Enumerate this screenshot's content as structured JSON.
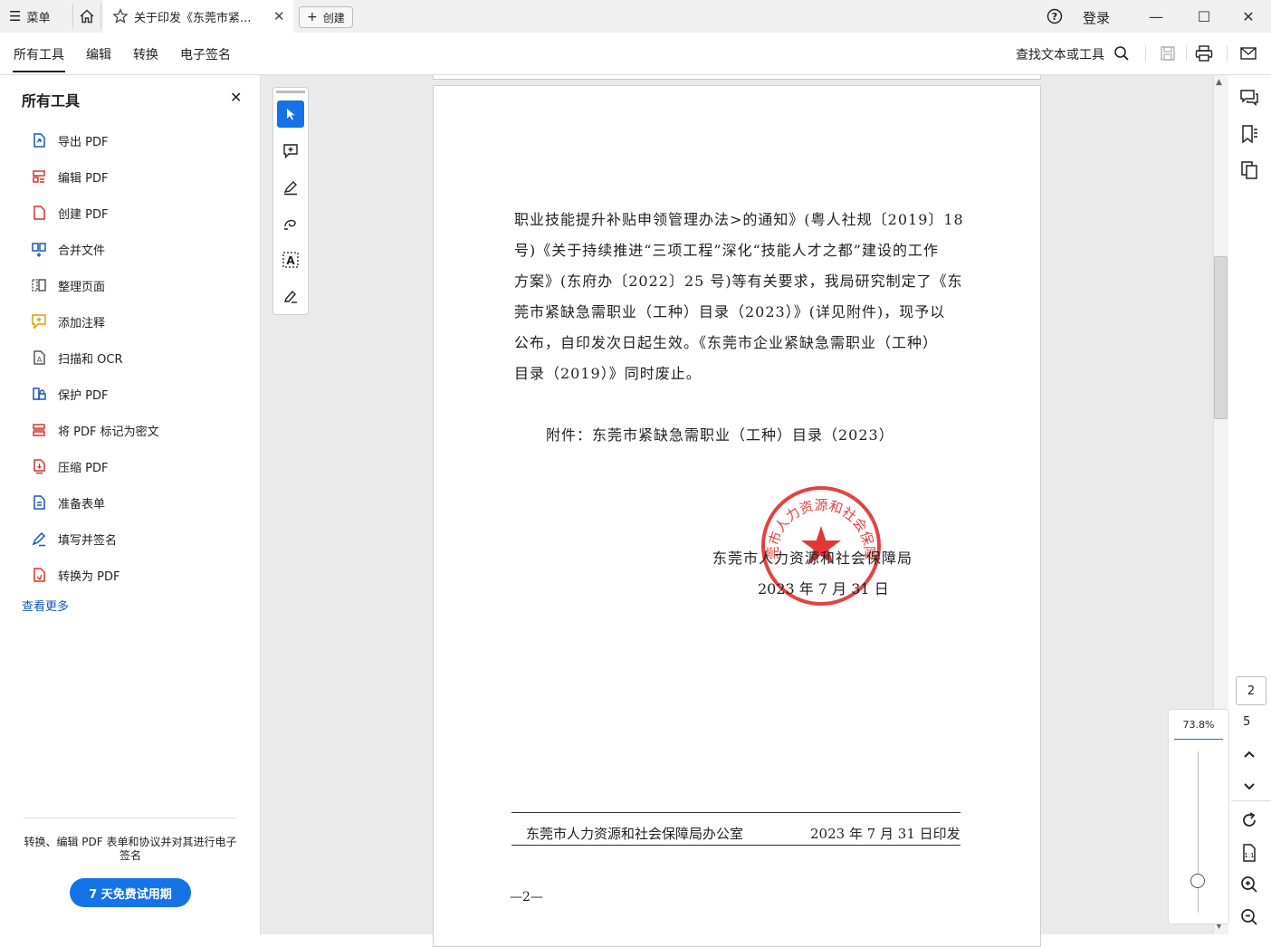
{
  "titlebar": {
    "menu_label": "菜单",
    "tab_title": "关于印发《东莞市紧...",
    "create_label": "创建",
    "login_label": "登录"
  },
  "menubar": {
    "tabs": [
      "所有工具",
      "编辑",
      "转换",
      "电子签名"
    ],
    "active_tab": "所有工具",
    "search_tools": "查找文本或工具"
  },
  "left_panel": {
    "title": "所有工具",
    "tools": [
      {
        "label": "导出 PDF",
        "icon": "export-pdf-icon",
        "color": "#1a55c0"
      },
      {
        "label": "编辑 PDF",
        "icon": "edit-pdf-icon",
        "color": "#d6352b"
      },
      {
        "label": "创建 PDF",
        "icon": "create-pdf-icon",
        "color": "#d6352b"
      },
      {
        "label": "合并文件",
        "icon": "combine-files-icon",
        "color": "#1a55c0"
      },
      {
        "label": "整理页面",
        "icon": "organize-pages-icon",
        "color": "#555555"
      },
      {
        "label": "添加注释",
        "icon": "comment-icon",
        "color": "#e69a00"
      },
      {
        "label": "扫描和 OCR",
        "icon": "scan-ocr-icon",
        "color": "#555555"
      },
      {
        "label": "保护 PDF",
        "icon": "protect-pdf-icon",
        "color": "#1a55c0"
      },
      {
        "label": "将 PDF 标记为密文",
        "icon": "redact-icon",
        "color": "#d6352b"
      },
      {
        "label": "压缩 PDF",
        "icon": "compress-pdf-icon",
        "color": "#d6352b"
      },
      {
        "label": "准备表单",
        "icon": "prepare-form-icon",
        "color": "#1a55c0"
      },
      {
        "label": "填写并签名",
        "icon": "fill-sign-icon",
        "color": "#1a55c0"
      },
      {
        "label": "转换为 PDF",
        "icon": "convert-to-pdf-icon",
        "color": "#d6352b"
      }
    ],
    "see_more": "查看更多",
    "promo_text": "转换、编辑 PDF 表单和协议并对其进行电子签名",
    "trial_button": "7 天免费试用期"
  },
  "document": {
    "paragraph_lines": [
      "职业技能提升补贴申领管理办法>的通知》(粤人社规〔2019〕18",
      "号)《关于持续推进“三项工程”深化“技能人才之都”建设的工作",
      "方案》(东府办〔2022〕25 号)等有关要求，我局研究制定了《东",
      "莞市紧缺急需职业（工种）目录（2023）》(详见附件)，现予以",
      "公布，自印发次日起生效。《东莞市企业紧缺急需职业（工种）",
      "目录（2019）》同时废止。"
    ],
    "attachment": "附件：东莞市紧缺急需职业（工种）目录（2023）",
    "signature_org": "东莞市人力资源和社会保障局",
    "signature_date": "2023 年 7 月 31 日",
    "seal_text": "东莞市人力资源和社会保障局",
    "footer_org": "东莞市人力资源和社会保障局办公室",
    "footer_date": "2023 年 7 月 31 日印发",
    "page_marker": "—2—"
  },
  "navigation": {
    "current_page": "2",
    "total_pages": "5",
    "zoom": "73.8%",
    "zoom_level_fraction": 0.2
  },
  "colors": {
    "accent": "#1473e6",
    "seal_red": "#e02020"
  }
}
